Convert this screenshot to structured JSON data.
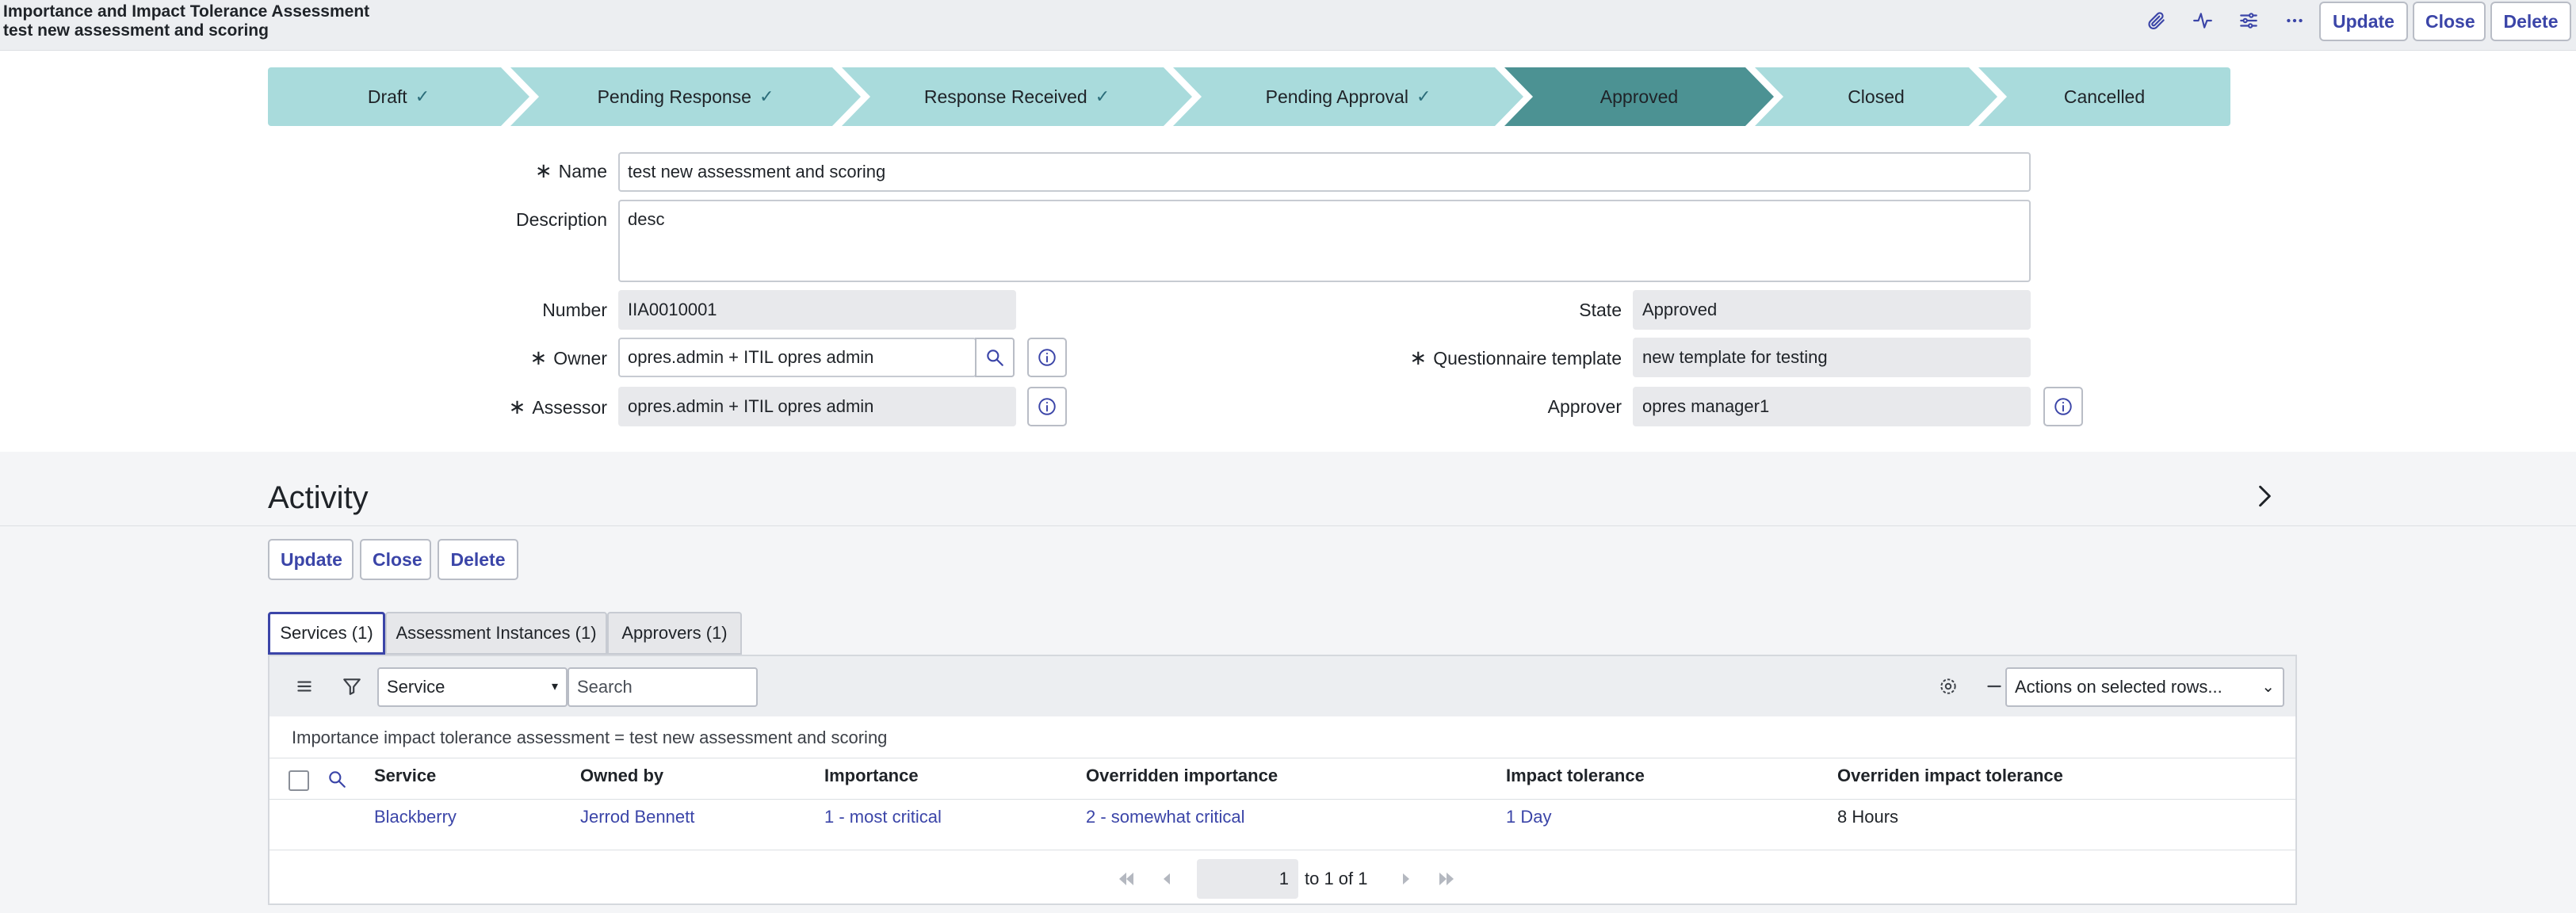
{
  "header": {
    "title": "Importance and Impact Tolerance Assessment",
    "subtitle": "test new assessment and scoring",
    "icons": [
      "paperclip-icon",
      "activity-pulse-icon",
      "sliders-icon",
      "more-icon"
    ],
    "buttons": {
      "update": "Update",
      "close": "Close",
      "delete": "Delete"
    }
  },
  "stepper": {
    "steps": [
      {
        "label": "Draft",
        "done": true
      },
      {
        "label": "Pending Response",
        "done": true
      },
      {
        "label": "Response Received",
        "done": true
      },
      {
        "label": "Pending Approval",
        "done": true
      },
      {
        "label": "Approved",
        "current": true
      },
      {
        "label": "Closed"
      },
      {
        "label": "Cancelled"
      }
    ],
    "check_glyph": "✓",
    "colors": {
      "step": "#a9dbdc",
      "current": "#4c9293"
    }
  },
  "form": {
    "name": {
      "label": "Name",
      "value": "test new assessment and scoring",
      "required": true
    },
    "description": {
      "label": "Description",
      "value": "desc"
    },
    "number": {
      "label": "Number",
      "value": "IIA0010001"
    },
    "owner": {
      "label": "Owner",
      "value": "opres.admin + ITIL opres admin",
      "required": true
    },
    "assessor": {
      "label": "Assessor",
      "value": "opres.admin + ITIL opres admin",
      "required": true
    },
    "state": {
      "label": "State",
      "value": "Approved"
    },
    "questionnaire_template": {
      "label": "Questionnaire template",
      "value": "new template for testing",
      "required": true
    },
    "approver": {
      "label": "Approver",
      "value": "opres manager1"
    },
    "required_glyph": "∗"
  },
  "activity": {
    "title": "Activity",
    "buttons": {
      "update": "Update",
      "close": "Close",
      "delete": "Delete"
    }
  },
  "tabs": [
    {
      "label": "Services (1)",
      "active": true
    },
    {
      "label": "Assessment Instances (1)"
    },
    {
      "label": "Approvers (1)"
    }
  ],
  "list": {
    "search_field": "Service",
    "search_placeholder": "Search",
    "actions_select": "Actions on selected rows...",
    "breadcrumb": "Importance impact tolerance assessment = test new assessment and scoring",
    "columns": [
      "Service",
      "Owned by",
      "Importance",
      "Overridden importance",
      "Impact tolerance",
      "Overriden impact tolerance"
    ],
    "rows": [
      {
        "cells": [
          "Blackberry",
          "Jerrod Bennett",
          "1 - most critical",
          "2 - somewhat critical",
          "1 Day",
          "8 Hours"
        ]
      }
    ],
    "pager": {
      "page": "1",
      "text": "to 1 of 1"
    }
  },
  "colors": {
    "accent": "#3b45a8"
  }
}
